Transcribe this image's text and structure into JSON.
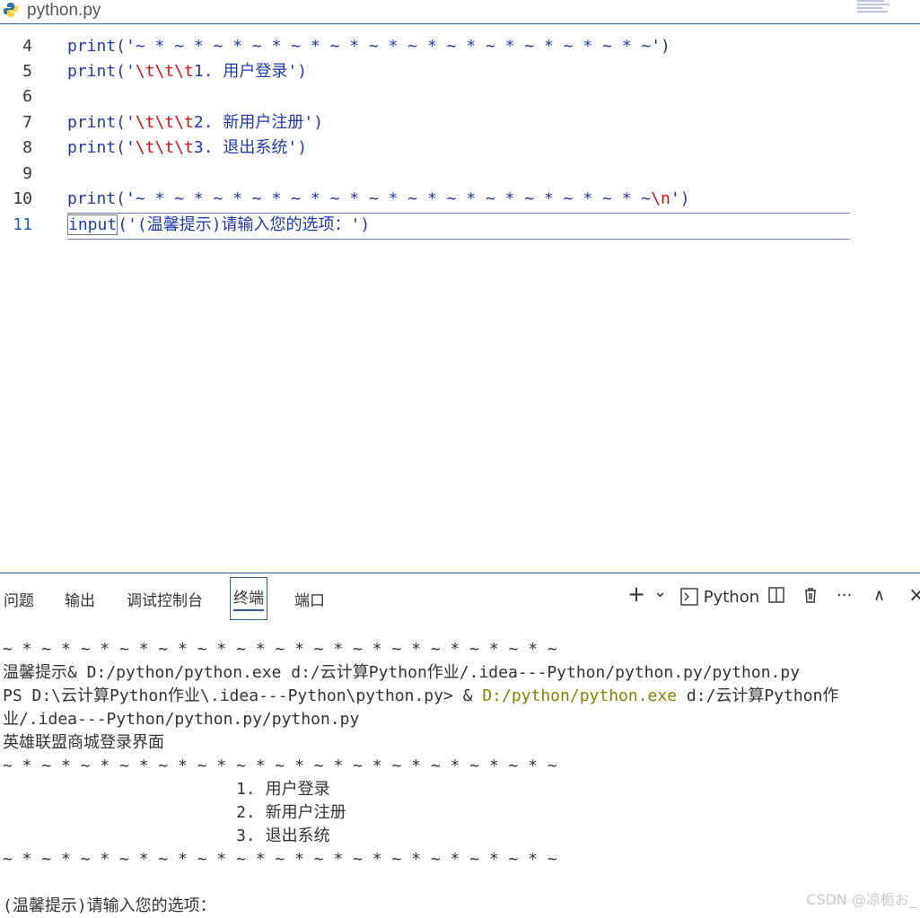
{
  "tab": {
    "title": "python.py",
    "icon": "python-icon"
  },
  "editor": {
    "lines": [
      {
        "n": "4",
        "text": "print('~ * ~ * ~ * ~ * ~ * ~ * ~ * ~ * ~ * ~ * ~ * ~ * ~ * ~')"
      },
      {
        "n": "5",
        "pre": "print('",
        "esc": "\\t\\t\\t",
        "post": "1. 用户登录')"
      },
      {
        "n": "6",
        "text": ""
      },
      {
        "n": "7",
        "pre": "print('",
        "esc": "\\t\\t\\t",
        "post": "2. 新用户注册')"
      },
      {
        "n": "8",
        "pre": "print('",
        "esc": "\\t\\t\\t",
        "post": "3. 退出系统')"
      },
      {
        "n": "9",
        "text": ""
      },
      {
        "n": "10",
        "pre": "print('~ * ~ * ~ * ~ * ~ * ~ * ~ * ~ * ~ * ~ * ~ * ~ * ~ * ~",
        "esc": "\\n",
        "post": "')"
      },
      {
        "n": "11",
        "pre": "input",
        "mid": "('(温馨提示)请输入您的选项：')"
      }
    ]
  },
  "panel": {
    "tabs": [
      "问题",
      "输出",
      "调试控制台",
      "终端",
      "端口"
    ],
    "active_tab": "终端",
    "actions": {
      "add": "+",
      "dropdown": "⌄",
      "shell_label": "Python",
      "split": "◫",
      "trash": "🗑",
      "more": "···",
      "collapse": "∧",
      "close": "×"
    },
    "terminal_lines": [
      "~ * ~ * ~ * ~ * ~ * ~ * ~ * ~ * ~ * ~ * ~ * ~ * ~ * ~ * ~",
      "温馨提示& D:/python/python.exe d:/云计算Python作业/.idea---Python/python.py/python.py",
      "PS D:\\云计算Python作业\\.idea---Python\\python.py> & ",
      "业/.idea---Python/python.py/python.py",
      "英雄联盟商城登录界面",
      "~ * ~ * ~ * ~ * ~ * ~ * ~ * ~ * ~ * ~ * ~ * ~ * ~ * ~ * ~",
      "                        1. 用户登录",
      "                        2. 新用户注册",
      "                        3. 退出系统",
      "~ * ~ * ~ * ~ * ~ * ~ * ~ * ~ * ~ * ~ * ~ * ~ * ~ * ~ * ~",
      "",
      "(温馨提示)请输入您的选项："
    ],
    "ps_highlight": "D:/python/python.exe",
    "ps_tail": " d:/云计算Python作",
    "watermark": "CSDN @凉栀お_"
  },
  "colors": {
    "accent": "#2f5d9e",
    "keyword": "#1f3aa8",
    "escape": "#d01010"
  }
}
